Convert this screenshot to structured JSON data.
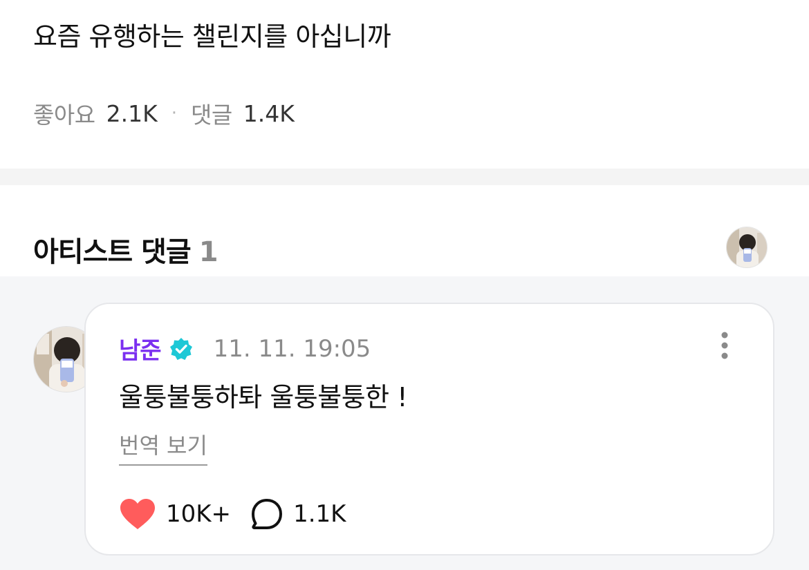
{
  "post": {
    "text": "요즘 유행하는 챌린지를 아십니까",
    "likes_label": "좋아요",
    "likes_count": "2.1K",
    "separator": "·",
    "comments_label": "댓글",
    "comments_count": "1.4K"
  },
  "artist_comments": {
    "title": "아티스트 댓글",
    "count": "1"
  },
  "comment": {
    "author": "남준",
    "verified": true,
    "timestamp": "11. 11. 19:05",
    "text": "울퉁불퉁하톼 울퉁불퉁한 !",
    "translate_label": "번역 보기",
    "like_count": "10K+",
    "reply_count": "1.1K"
  },
  "colors": {
    "accent_purple": "#7b2ff0",
    "verified_badge": "#1ec8d6",
    "heart": "#ff5c5c",
    "muted_text": "#8a8a8a",
    "comment_bg": "#f5f6f8"
  },
  "icons": {
    "verified": "verified-badge-icon",
    "more": "more-vertical-icon",
    "like": "heart-icon",
    "reply": "speech-bubble-icon"
  }
}
